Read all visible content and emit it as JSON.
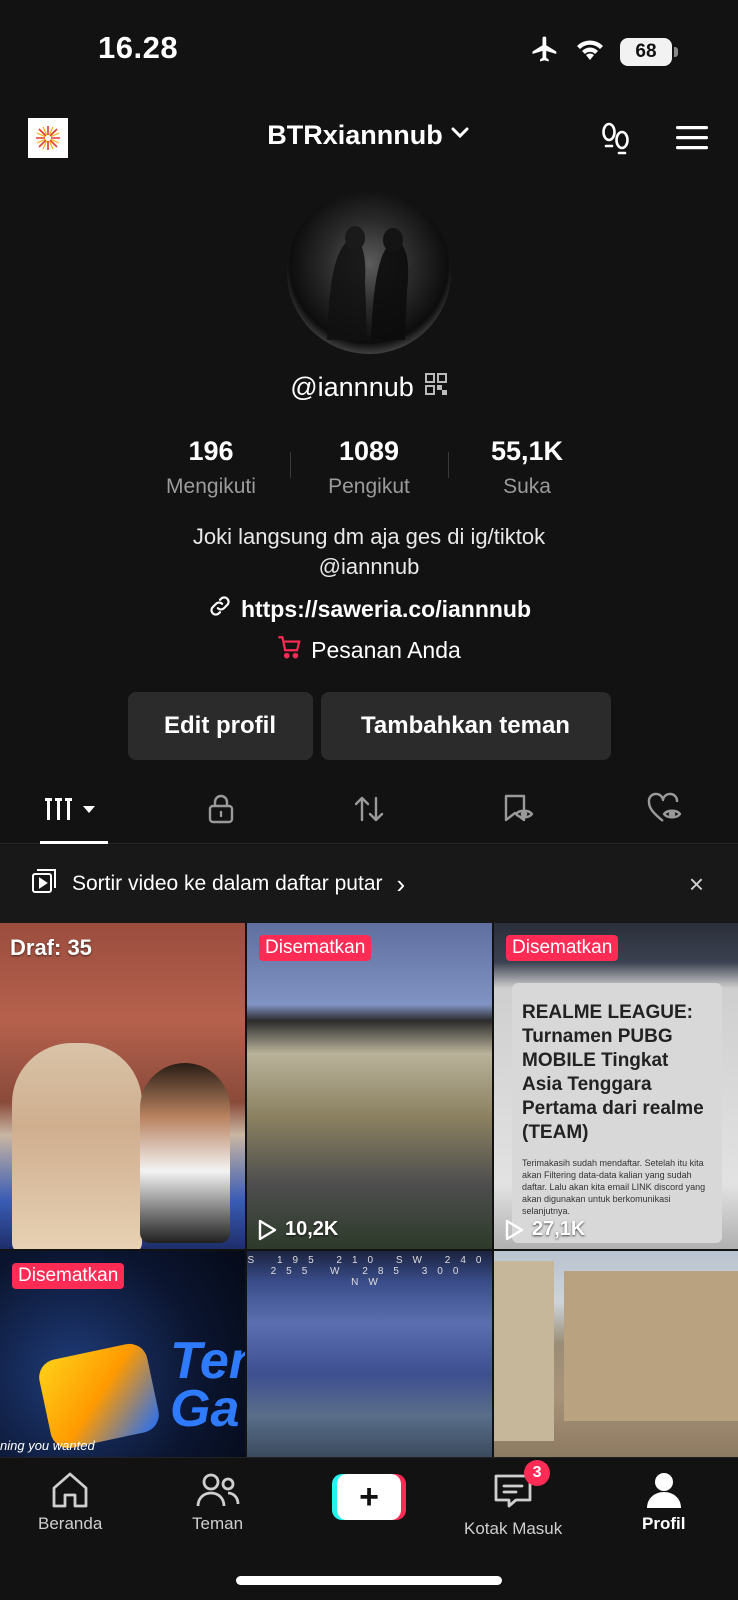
{
  "status_bar": {
    "time": "16.28",
    "battery": "68"
  },
  "header": {
    "username": "BTRxiannnub"
  },
  "profile": {
    "handle": "@iannnub",
    "stats": [
      {
        "value": "196",
        "label": "Mengikuti"
      },
      {
        "value": "1089",
        "label": "Pengikut"
      },
      {
        "value": "55,1K",
        "label": "Suka"
      }
    ],
    "bio_line1": "Joki langsung dm aja ges di ig/tiktok",
    "bio_line2": "@iannnub",
    "link": "https://saweria.co/iannnub",
    "orders": "Pesanan Anda"
  },
  "buttons": {
    "edit": "Edit profil",
    "add_friend": "Tambahkan teman"
  },
  "banner": {
    "text": "Sortir video ke dalam daftar putar",
    "chevron": "›",
    "close": "×"
  },
  "videos": [
    {
      "draft": "Draf: 35"
    },
    {
      "badge": "Disematkan",
      "views": "10,2K"
    },
    {
      "badge": "Disematkan",
      "views": "27,1K",
      "sign_title": "REALME LEAGUE: Turnamen PUBG MOBILE Tingkat Asia Tenggara Pertama dari realme (TEAM)",
      "sign_body": "Terimakasih sudah mendaftar. Setelah itu kita akan Filtering data-data kalian yang sudah daftar. Lalu akan kita email LINK discord yang akan digunakan untuk berkomunikasi selanjutnya."
    },
    {
      "badge": "Disematkan",
      "logo_text": "Ten Ga",
      "caption": "ning you wanted"
    },
    {
      "compass": "S 195 210 SW 240 255 W 285 300 NW"
    },
    {}
  ],
  "nav": {
    "home": "Beranda",
    "friends": "Teman",
    "plus": "+",
    "inbox": "Kotak Masuk",
    "inbox_badge": "3",
    "profile": "Profil"
  },
  "colors": {
    "accent": "#fe2c55",
    "cyan": "#25f4ee",
    "background": "#121212"
  }
}
